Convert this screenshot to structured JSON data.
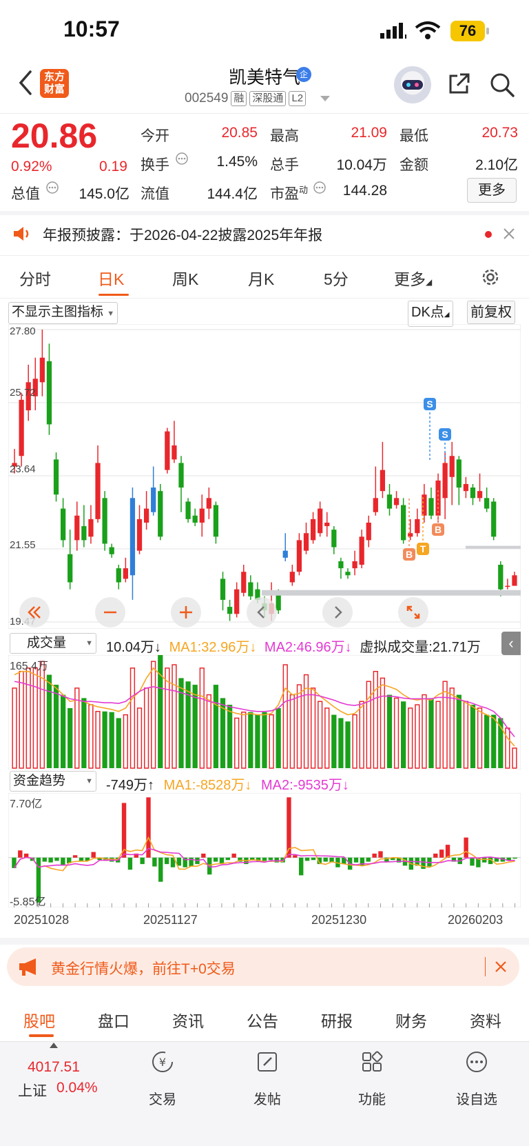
{
  "status": {
    "time": "10:57",
    "battery": "76"
  },
  "header": {
    "logo": [
      "东方",
      "财富"
    ],
    "stock_name": "凯美特气",
    "qi_badge": "企",
    "code": "002549",
    "tags": [
      "融",
      "深股通",
      "L2"
    ]
  },
  "quote": {
    "price": "20.86",
    "change_pct": "0.92%",
    "change": "0.19",
    "rows": [
      [
        {
          "label": "今开",
          "value": "20.85",
          "red": true
        },
        {
          "label": "最高",
          "value": "21.09",
          "red": true
        },
        {
          "label": "最低",
          "value": "20.73",
          "red": true
        }
      ],
      [
        {
          "label": "换手",
          "value": "1.45%",
          "red": false
        },
        {
          "label": "总手",
          "value": "10.04万",
          "red": false
        },
        {
          "label": "金额",
          "value": "2.10亿",
          "red": false
        }
      ]
    ],
    "total_value_label": "总值",
    "total_value": "145.0亿",
    "float_value_label": "流值",
    "float_value": "144.4亿",
    "pe_label": "市盈",
    "pe_sup": "动",
    "pe": "144.28",
    "more": "更多"
  },
  "notice": {
    "text": "年报预披露：于2026-04-22披露2025年年报"
  },
  "tabs": [
    "分时",
    "日K",
    "周K",
    "月K",
    "5分",
    "更多"
  ],
  "active_tab": "日K",
  "chart": {
    "indicator_select": "不显示主图指标",
    "dk_point": "DK点",
    "adjust": "前复权",
    "y_ticks": [
      "27.80",
      "25.72",
      "23.64",
      "21.55",
      "19.47"
    ],
    "volume": {
      "select": "成交量",
      "value": "10.04万↓",
      "ma1": "MA1:32.96万↓",
      "ma2": "MA2:46.96万↓",
      "virtual": "虚拟成交量:21.71万",
      "max": "165.4万"
    },
    "fund": {
      "select": "资金趋势",
      "value": "-749万↑",
      "ma1": "MA1:-8528万↓",
      "ma2": "MA2:-9535万↓",
      "max": "7.70亿",
      "min": "-5.85亿"
    },
    "dates": [
      "20251028",
      "20251127",
      "20251230",
      "20260203"
    ],
    "signals": [
      "S",
      "S",
      "B",
      "T",
      "B"
    ],
    "colors": {
      "up": "#e8272c",
      "down": "#1aa01a",
      "accent": "#f05a1a",
      "ma1": "#f5a623",
      "ma2": "#e33ad2",
      "blue": "#2f7fd8"
    }
  },
  "chart_data": {
    "type": "candlestick",
    "ylim": [
      19.47,
      27.8
    ],
    "candles": [
      [
        23.9,
        24.0,
        24.4,
        23.7
      ],
      [
        24.2,
        25.8,
        26.0,
        23.9
      ],
      [
        25.5,
        26.3,
        26.8,
        25.2
      ],
      [
        25.9,
        26.4,
        27.0,
        25.5
      ],
      [
        26.3,
        27.0,
        27.8,
        25.9
      ],
      [
        26.9,
        25.1,
        27.4,
        24.8
      ],
      [
        24.1,
        23.1,
        24.3,
        22.9
      ],
      [
        22.7,
        21.8,
        23.0,
        21.6
      ],
      [
        21.4,
        20.6,
        22.1,
        20.4
      ],
      [
        21.8,
        22.5,
        22.9,
        21.5
      ],
      [
        22.2,
        21.8,
        22.8,
        21.6
      ],
      [
        21.9,
        22.4,
        22.8,
        21.7
      ],
      [
        22.4,
        24.0,
        24.5,
        22.3
      ],
      [
        23.0,
        21.7,
        23.2,
        21.5
      ],
      [
        21.6,
        21.4,
        21.7,
        21.3
      ],
      [
        21.0,
        20.6,
        21.1,
        20.4
      ],
      [
        20.7,
        21.0,
        21.3,
        20.6
      ],
      [
        20.8,
        23.0,
        23.3,
        20.1
      ],
      [
        21.5,
        22.4,
        22.8,
        21.4
      ],
      [
        22.3,
        22.7,
        23.2,
        22.1
      ],
      [
        22.6,
        23.3,
        23.9,
        22.5
      ],
      [
        23.2,
        21.9,
        23.4,
        21.8
      ],
      [
        23.8,
        24.9,
        25.0,
        23.7
      ],
      [
        24.1,
        24.5,
        25.2,
        24.0
      ],
      [
        24.0,
        23.3,
        24.2,
        22.6
      ],
      [
        22.9,
        22.4,
        23.0,
        22.3
      ],
      [
        22.5,
        22.3,
        22.7,
        22.2
      ],
      [
        22.3,
        22.7,
        23.1,
        21.9
      ],
      [
        22.7,
        23.0,
        23.3,
        22.4
      ],
      [
        22.8,
        21.9,
        22.9,
        21.7
      ],
      [
        20.7,
        20.1,
        20.9,
        19.8
      ],
      [
        19.9,
        19.7,
        20.1,
        19.5
      ],
      [
        19.7,
        20.4,
        20.6,
        19.6
      ],
      [
        20.3,
        20.9,
        21.1,
        20.2
      ],
      [
        20.6,
        20.2,
        20.8,
        20.1
      ],
      [
        20.4,
        20.1,
        20.6,
        20.0
      ],
      [
        20.0,
        19.8,
        20.2,
        19.6
      ],
      [
        19.7,
        20.0,
        20.6,
        19.5
      ],
      [
        20.3,
        19.8,
        20.4,
        19.7
      ],
      [
        21.3,
        21.5,
        22.0,
        21.2
      ],
      [
        20.6,
        20.9,
        21.1,
        20.5
      ],
      [
        20.9,
        21.8,
        22.0,
        20.8
      ],
      [
        21.5,
        22.0,
        22.3,
        21.4
      ],
      [
        21.8,
        22.4,
        22.6,
        21.7
      ],
      [
        22.0,
        22.7,
        22.9,
        21.9
      ],
      [
        22.2,
        22.3,
        22.6,
        21.9
      ],
      [
        22.1,
        21.6,
        22.2,
        21.4
      ],
      [
        21.2,
        21.0,
        21.3,
        20.7
      ],
      [
        20.9,
        20.8,
        21.0,
        20.7
      ],
      [
        21.0,
        21.2,
        21.5,
        20.8
      ],
      [
        21.1,
        21.9,
        22.1,
        21.0
      ],
      [
        21.8,
        22.3,
        22.5,
        21.6
      ],
      [
        22.6,
        23.0,
        23.9,
        22.5
      ],
      [
        23.2,
        23.8,
        24.6,
        23.0
      ],
      [
        23.1,
        22.7,
        23.4,
        22.5
      ],
      [
        22.8,
        23.0,
        23.2,
        22.7
      ],
      [
        22.8,
        21.8,
        23.0,
        21.7
      ],
      [
        21.9,
        22.0,
        22.4,
        21.8
      ],
      [
        22.0,
        22.4,
        22.7,
        21.9
      ],
      [
        22.5,
        23.1,
        23.4,
        22.3
      ],
      [
        23.0,
        22.5,
        23.3,
        22.4
      ],
      [
        22.5,
        23.5,
        23.7,
        22.3
      ],
      [
        23.0,
        24.0,
        24.3,
        22.4
      ],
      [
        23.6,
        24.2,
        24.6,
        22.8
      ],
      [
        24.1,
        23.3,
        24.2,
        22.8
      ],
      [
        23.2,
        23.4,
        23.6,
        23.0
      ],
      [
        23.3,
        23.0,
        23.4,
        22.8
      ],
      [
        23.0,
        23.2,
        23.7,
        22.9
      ],
      [
        23.0,
        22.7,
        23.3,
        22.6
      ],
      [
        22.9,
        21.9,
        23.0,
        21.8
      ],
      [
        21.1,
        20.4,
        21.2,
        20.2
      ],
      [
        20.5,
        20.5,
        20.7,
        20.4
      ],
      [
        20.5,
        20.8,
        20.9,
        20.5
      ]
    ],
    "volume_wan": [
      120,
      145,
      150,
      150,
      160,
      140,
      125,
      110,
      90,
      120,
      105,
      95,
      85,
      85,
      84,
      75,
      80,
      150,
      90,
      120,
      160,
      180,
      150,
      155,
      135,
      130,
      125,
      150,
      110,
      125,
      105,
      95,
      75,
      84,
      84,
      80,
      84,
      80,
      90,
      155,
      110,
      125,
      140,
      120,
      100,
      90,
      80,
      75,
      70,
      80,
      100,
      130,
      145,
      135,
      110,
      105,
      100,
      90,
      95,
      110,
      105,
      100,
      130,
      120,
      110,
      100,
      95,
      90,
      80,
      80,
      75,
      60,
      30
    ],
    "vol_ma1_wan": [
      140,
      145,
      145,
      140,
      135,
      128,
      120,
      110,
      100,
      102,
      100,
      95,
      92,
      90,
      88,
      85,
      90,
      105,
      115,
      135,
      150,
      140,
      130,
      125,
      120,
      115,
      110,
      108,
      102,
      95,
      90,
      85,
      82,
      80,
      82,
      80,
      80,
      82,
      95,
      120,
      110,
      112,
      120,
      118,
      108,
      100,
      92,
      85,
      80,
      82,
      92,
      105,
      118,
      125,
      122,
      118,
      110,
      104,
      102,
      104,
      102,
      110,
      115,
      110,
      104,
      98,
      92,
      85,
      80,
      75,
      62,
      45,
      33
    ],
    "vol_ma2_wan": [
      130,
      128,
      125,
      122,
      118,
      115,
      112,
      108,
      104,
      102,
      100,
      100,
      99,
      98,
      98,
      97,
      100,
      108,
      115,
      120,
      122,
      120,
      118,
      116,
      113,
      110,
      106,
      104,
      100,
      98,
      95,
      92,
      90,
      88,
      86,
      85,
      85,
      86,
      90,
      100,
      103,
      107,
      110,
      110,
      108,
      105,
      102,
      98,
      95,
      94,
      96,
      100,
      105,
      108,
      108,
      107,
      105,
      104,
      104,
      104,
      104,
      106,
      106,
      105,
      103,
      100,
      97,
      93,
      90,
      85,
      75,
      60,
      47
    ],
    "fund_flow_yi": [
      -1.3,
      0.9,
      0.5,
      -0.4,
      -5.6,
      -0.5,
      -0.6,
      -0.4,
      -1.0,
      -0.7,
      0.3,
      -0.4,
      -0.4,
      0.7,
      -0.3,
      -0.4,
      -0.5,
      -0.6,
      6.8,
      -1.5,
      0.5,
      -0.8,
      7.5,
      -1.1,
      -3.0,
      -0.8,
      -1.2,
      -1.0,
      -1.2,
      -1.1,
      -0.8,
      0.5,
      -2.1,
      -0.5,
      -0.8,
      -0.3,
      0.5,
      -0.5,
      -0.8,
      -0.3,
      -0.5,
      -0.4,
      -0.3,
      -0.6,
      -0.6,
      7.5,
      0.3,
      -2.2,
      -0.4,
      -0.3,
      -0.8,
      -0.5,
      -0.6,
      -1.2,
      -0.8,
      -1.5,
      -0.6,
      -1.0,
      -0.5,
      0.5,
      0.8,
      -0.5,
      -0.3,
      -0.6,
      -1.0,
      -1.5,
      -1.0,
      -1.4,
      -1.1,
      0.5,
      1.0,
      1.6,
      -0.5,
      -0.8,
      2.5,
      -1.0,
      -1.2,
      -0.6,
      -0.8,
      -0.5,
      -0.5,
      -0.4,
      -0.07
    ]
  },
  "banner": {
    "text": "黄金行情火爆，前往T+0交易"
  },
  "bottom_tabs": [
    "股吧",
    "盘口",
    "资讯",
    "公告",
    "研报",
    "财务",
    "资料"
  ],
  "active_bottom_tab": "股吧",
  "index": {
    "value": "4017.51",
    "name": "上证",
    "pct": "0.04%"
  },
  "bottom_bar": [
    "交易",
    "发帖",
    "功能",
    "设自选"
  ]
}
